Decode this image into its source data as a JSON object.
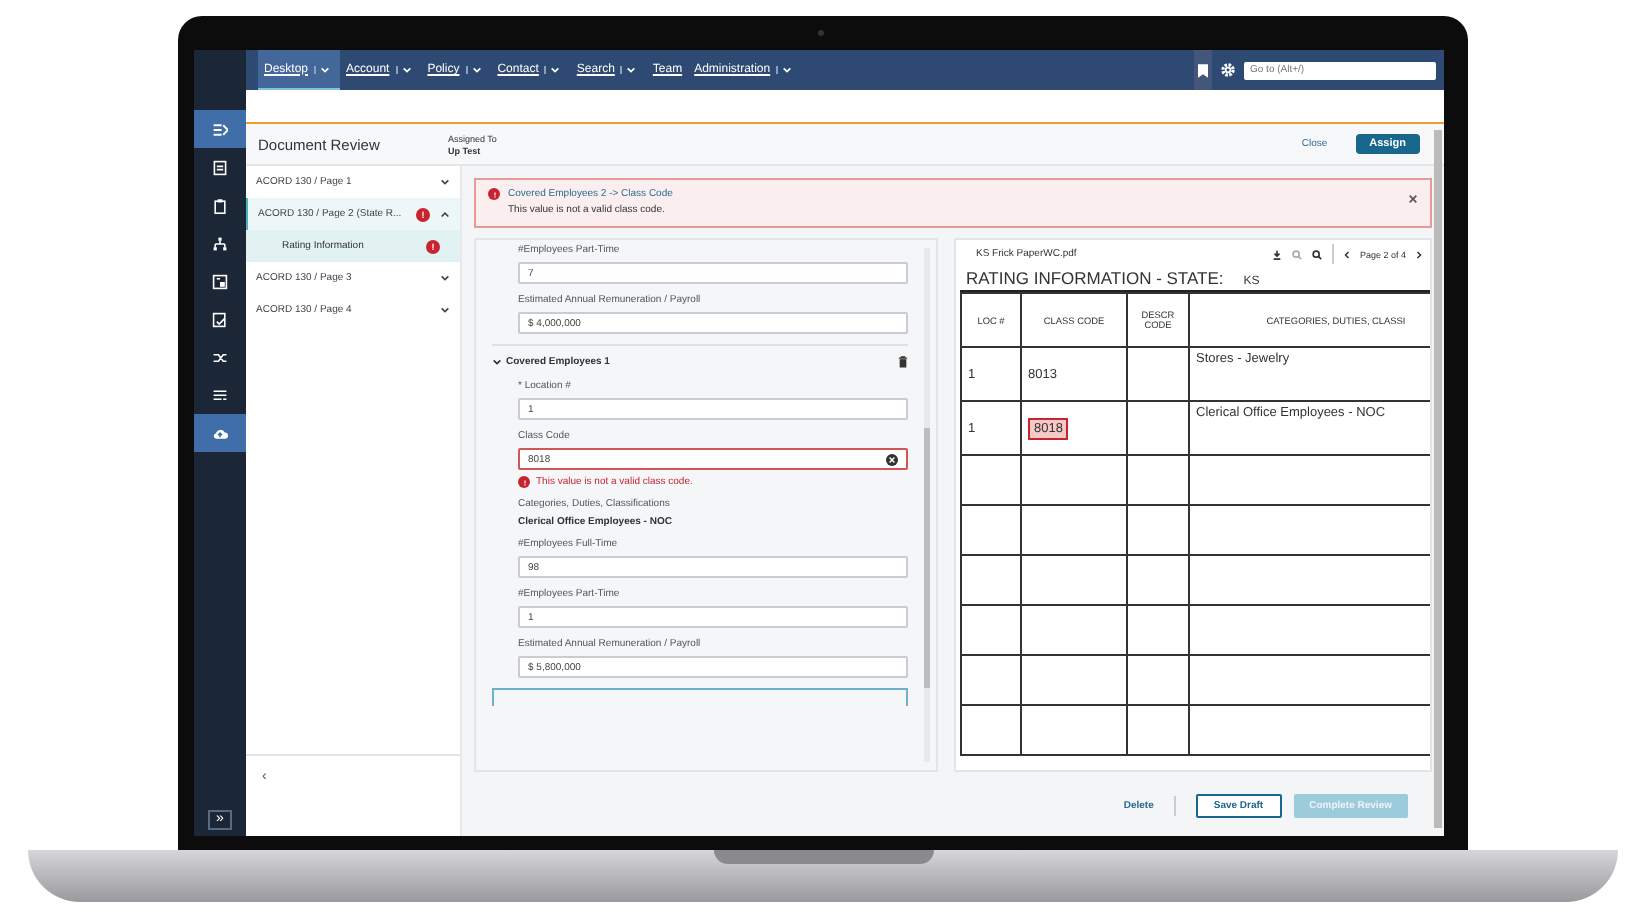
{
  "rail": {
    "items": [
      {
        "kind": "exit",
        "selected": true
      },
      {
        "kind": "list",
        "selected": false
      },
      {
        "kind": "clipboard",
        "selected": false
      },
      {
        "kind": "hierarchy",
        "selected": false
      },
      {
        "kind": "grid",
        "selected": false
      },
      {
        "kind": "document",
        "selected": false
      },
      {
        "kind": "shuffle",
        "selected": false
      },
      {
        "kind": "lines",
        "selected": false
      },
      {
        "kind": "cloud",
        "selected": true
      }
    ],
    "expand": "»"
  },
  "nav": {
    "items": [
      {
        "label": "Desktop",
        "selected": true,
        "dropdown": true
      },
      {
        "label": "Account",
        "selected": false,
        "dropdown": true
      },
      {
        "label": "Policy",
        "selected": false,
        "dropdown": true
      },
      {
        "label": "Contact",
        "selected": false,
        "dropdown": true
      },
      {
        "label": "Search",
        "selected": false,
        "dropdown": true
      },
      {
        "label": "Team",
        "selected": false,
        "dropdown": false
      },
      {
        "label": "Administration",
        "selected": false,
        "dropdown": true
      }
    ],
    "search": {
      "placeholder": "Go to (Alt+/)"
    }
  },
  "header": {
    "title": "Document Review",
    "assigned_label": "Assigned To",
    "assigned_value": "Up Test",
    "close": "Close",
    "assign": "Assign"
  },
  "sections": [
    {
      "label": "ACORD 130 / Page 1",
      "expanded": false
    },
    {
      "label": "ACORD 130 / Page 2 (State R...",
      "badge": "!",
      "expanded": true,
      "children": [
        {
          "label": "Rating Information",
          "badge": "!",
          "selected": true
        }
      ]
    },
    {
      "label": "ACORD 130 / Page 3",
      "expanded": false
    },
    {
      "label": "ACORD 130 / Page 4",
      "expanded": false
    }
  ],
  "collapse": "‹",
  "alert": {
    "title": "Covered Employees 2 -> Class Code",
    "message": "This value is not a valid class code."
  },
  "form": {
    "items": [
      {
        "kind": "field",
        "label": "#Employees Part-Time",
        "value": "7"
      },
      {
        "kind": "field",
        "label": "Estimated Annual Remuneration / Payroll",
        "value": "$ 4,000,000"
      },
      {
        "kind": "group",
        "label": "Covered Employees 1",
        "expanded": true
      },
      {
        "kind": "field",
        "label": "Location #",
        "required_mark": "*",
        "value": "1"
      },
      {
        "kind": "field",
        "label": "Class Code",
        "value": "8018",
        "error": "This value is not a valid class code."
      },
      {
        "kind": "info",
        "label": "Categories, Duties, Classifications",
        "value": "Clerical Office Employees - NOC"
      },
      {
        "kind": "field",
        "label": "#Employees Full-Time",
        "value": "98"
      },
      {
        "kind": "field",
        "label": "#Employees Part-Time",
        "value": "1"
      },
      {
        "kind": "field",
        "label": "Estimated Annual Remuneration / Payroll",
        "value": "$ 5,800,000"
      }
    ]
  },
  "pdf": {
    "filename": "KS Frick PaperWC.pdf",
    "page": "Page 2 of 4",
    "heading": "RATING INFORMATION - STATE:",
    "state": "KS",
    "columns": [
      "LOC #",
      "CLASS CODE",
      "DESCR CODE",
      "CATEGORIES, DUTIES, CLASSI"
    ],
    "rows": [
      {
        "loc": "1",
        "class_code": "8013",
        "category": "Stores - Jewelry",
        "highlighted": false
      },
      {
        "loc": "1",
        "class_code": "8018",
        "category": "Clerical Office Employees - NOC",
        "highlighted": true
      }
    ]
  },
  "footer": {
    "delete": "Delete",
    "save_draft": "Save Draft",
    "complete": {
      "label": "Complete Review",
      "disabled": true
    }
  }
}
